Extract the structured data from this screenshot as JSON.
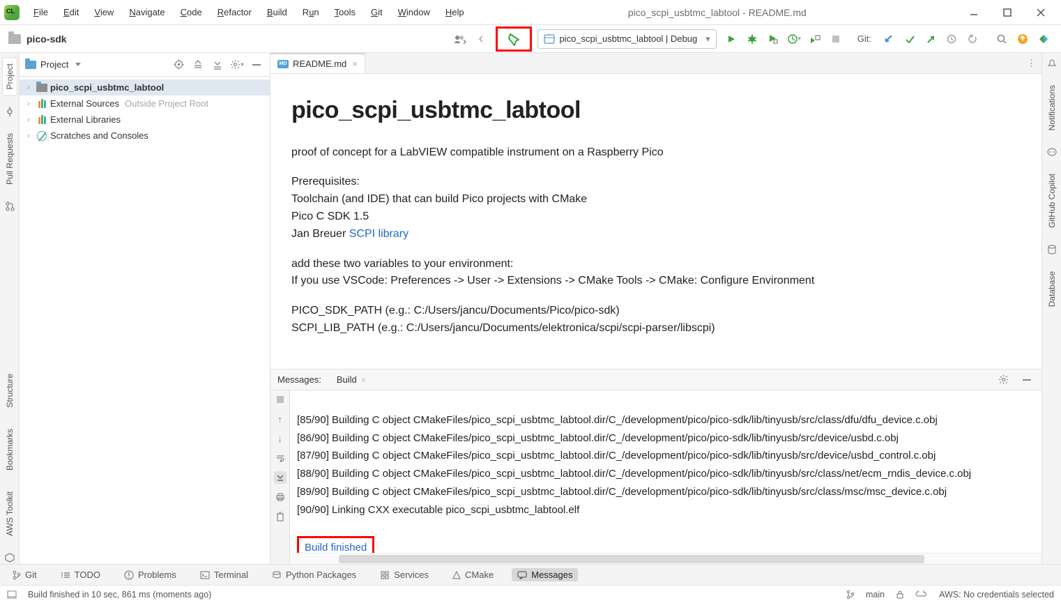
{
  "window": {
    "title": "pico_scpi_usbtmc_labtool - README.md"
  },
  "menu": {
    "file": "File",
    "edit": "Edit",
    "view": "View",
    "navigate": "Navigate",
    "code": "Code",
    "refactor": "Refactor",
    "build": "Build",
    "run": "Run",
    "tools": "Tools",
    "git": "Git",
    "window": "Window",
    "help": "Help"
  },
  "breadcrumb": {
    "project": "pico-sdk"
  },
  "toolbar": {
    "run_config": "pico_scpi_usbtmc_labtool | Debug",
    "git_label": "Git:"
  },
  "project_panel": {
    "title": "Project",
    "items": {
      "root": "pico_scpi_usbtmc_labtool",
      "ext_sources": "External Sources",
      "ext_sources_hint": "Outside Project Root",
      "ext_libs": "External Libraries",
      "scratches": "Scratches and Consoles"
    }
  },
  "editor": {
    "tab": "README.md",
    "readme": {
      "h1": "pico_scpi_usbtmc_labtool",
      "p1": "proof of concept for a LabVIEW compatible instrument on a Raspberry Pico",
      "pr_title": "Prerequisites:",
      "pr_l1": "Toolchain (and IDE) that can build Pico projects with CMake",
      "pr_l2": "Pico C SDK 1.5",
      "pr_l3a": "Jan Breuer ",
      "pr_l3link": "SCPI library",
      "env1": "add these two variables to your environment:",
      "env2": "If you use VSCode: Preferences -> User -> Extensions -> CMake Tools -> CMake: Configure Environment",
      "path1": "PICO_SDK_PATH (e.g.: C:/Users/jancu/Documents/Pico/pico-sdk)",
      "path2": "SCPI_LIB_PATH (e.g.: C:/Users/jancu/Documents/elektronica/scpi/scpi-parser/libscpi)"
    }
  },
  "messages": {
    "title": "Messages:",
    "active_tab": "Build",
    "lines": [
      "[85/90] Building C object CMakeFiles/pico_scpi_usbtmc_labtool.dir/C_/development/pico/pico-sdk/lib/tinyusb/src/class/dfu/dfu_device.c.obj",
      "[86/90] Building C object CMakeFiles/pico_scpi_usbtmc_labtool.dir/C_/development/pico/pico-sdk/lib/tinyusb/src/device/usbd.c.obj",
      "[87/90] Building C object CMakeFiles/pico_scpi_usbtmc_labtool.dir/C_/development/pico/pico-sdk/lib/tinyusb/src/device/usbd_control.c.obj",
      "[88/90] Building C object CMakeFiles/pico_scpi_usbtmc_labtool.dir/C_/development/pico/pico-sdk/lib/tinyusb/src/class/net/ecm_rndis_device.c.obj",
      "[89/90] Building C object CMakeFiles/pico_scpi_usbtmc_labtool.dir/C_/development/pico/pico-sdk/lib/tinyusb/src/class/msc/msc_device.c.obj",
      "[90/90] Linking CXX executable pico_scpi_usbtmc_labtool.elf"
    ],
    "build_finished": "Build finished"
  },
  "left_tabs": {
    "project": "Project",
    "pull": "Pull Requests",
    "structure": "Structure",
    "bookmarks": "Bookmarks",
    "aws": "AWS Toolkit"
  },
  "right_tabs": {
    "notifications": "Notifications",
    "copilot": "GitHub Copilot",
    "database": "Database"
  },
  "bottom": {
    "git": "Git",
    "todo": "TODO",
    "problems": "Problems",
    "terminal": "Terminal",
    "python": "Python Packages",
    "services": "Services",
    "cmake": "CMake",
    "messages": "Messages"
  },
  "status": {
    "text": "Build finished in 10 sec, 861 ms (moments ago)",
    "branch": "main",
    "lock": "",
    "aws": "AWS: No credentials selected"
  }
}
